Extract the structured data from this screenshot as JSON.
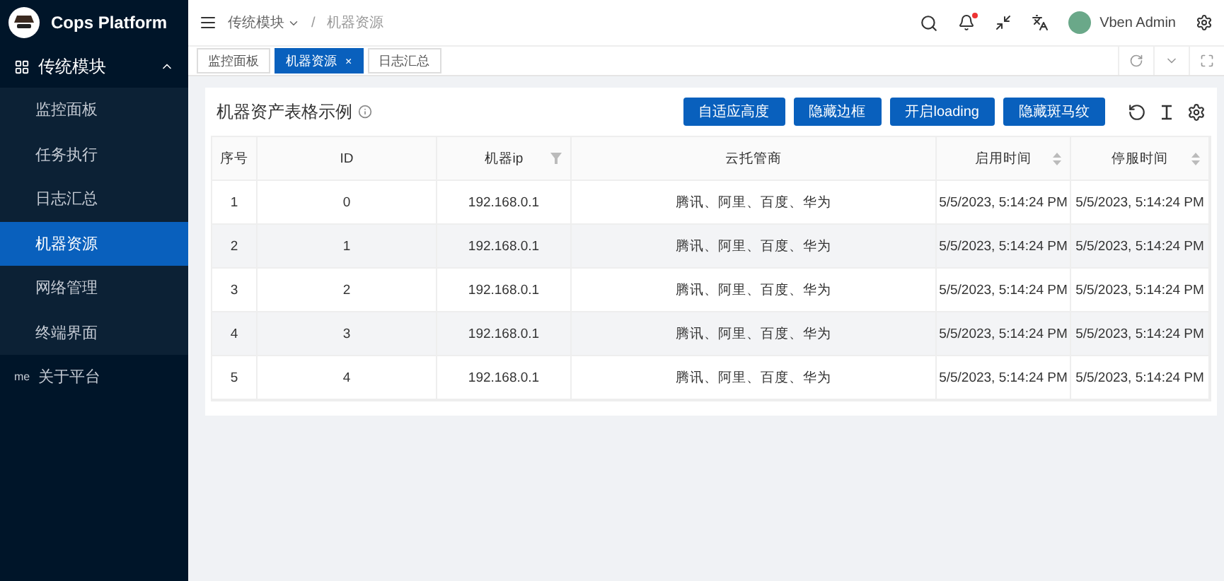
{
  "sidebar": {
    "brand": "Cops Platform",
    "groups": [
      {
        "label": "传统模块",
        "expanded": true,
        "items": [
          {
            "label": "监控面板",
            "selected": false
          },
          {
            "label": "任务执行",
            "selected": false
          },
          {
            "label": "日志汇总",
            "selected": false
          },
          {
            "label": "机器资源",
            "selected": true
          },
          {
            "label": "网络管理",
            "selected": false
          },
          {
            "label": "终端界面",
            "selected": false
          }
        ]
      }
    ],
    "extra_items": [
      {
        "prefix": "me",
        "label": "关于平台"
      }
    ]
  },
  "header": {
    "separator": "/",
    "breadcrumb": [
      {
        "label": "传统模块",
        "dropdown": true
      },
      {
        "label": "机器资源",
        "dropdown": false
      }
    ],
    "user": "Vben Admin"
  },
  "tab_close": "×",
  "tabs": [
    {
      "label": "监控面板",
      "selected": false
    },
    {
      "label": "机器资源",
      "selected": true
    },
    {
      "label": "日志汇总",
      "selected": false
    }
  ],
  "card": {
    "title": "机器资产表格示例",
    "buttons": [
      "自适应高度",
      "隐藏边框",
      "开启loading",
      "隐藏斑马纹"
    ]
  },
  "table": {
    "striped": true,
    "columns": [
      {
        "label": "序号",
        "kind": "plain"
      },
      {
        "label": "ID",
        "kind": "plain"
      },
      {
        "label": "机器ip",
        "kind": "filter"
      },
      {
        "label": "云托管商",
        "kind": "plain"
      },
      {
        "label": "启用时间",
        "kind": "sort"
      },
      {
        "label": "停服时间",
        "kind": "sort"
      }
    ],
    "rows": [
      [
        "1",
        "0",
        "192.168.0.1",
        "腾讯、阿里、百度、华为",
        "5/5/2023, 5:14:24 PM",
        "5/5/2023, 5:14:24 PM"
      ],
      [
        "2",
        "1",
        "192.168.0.1",
        "腾讯、阿里、百度、华为",
        "5/5/2023, 5:14:24 PM",
        "5/5/2023, 5:14:24 PM"
      ],
      [
        "3",
        "2",
        "192.168.0.1",
        "腾讯、阿里、百度、华为",
        "5/5/2023, 5:14:24 PM",
        "5/5/2023, 5:14:24 PM"
      ],
      [
        "4",
        "3",
        "192.168.0.1",
        "腾讯、阿里、百度、华为",
        "5/5/2023, 5:14:24 PM",
        "5/5/2023, 5:14:24 PM"
      ],
      [
        "5",
        "4",
        "192.168.0.1",
        "腾讯、阿里、百度、华为",
        "5/5/2023, 5:14:24 PM",
        "5/5/2023, 5:14:24 PM"
      ]
    ]
  }
}
